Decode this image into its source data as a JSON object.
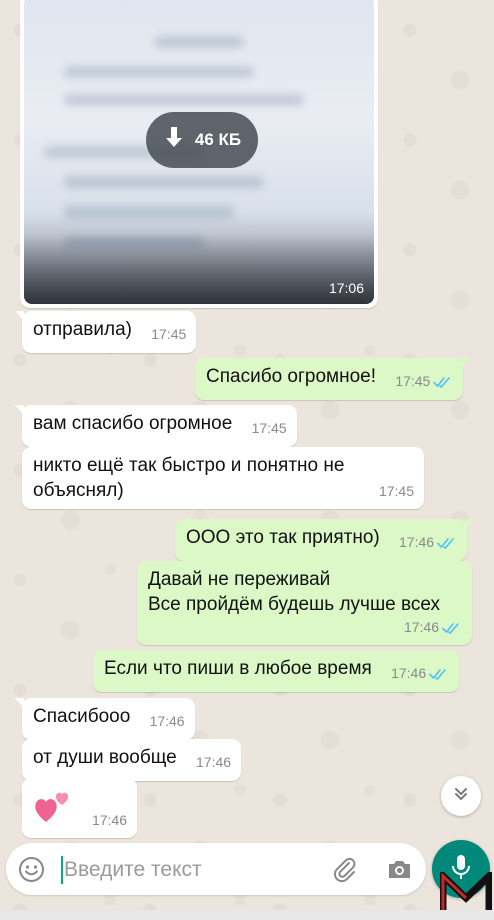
{
  "image_message": {
    "download_size": "46 КБ",
    "time": "17:06"
  },
  "messages": [
    {
      "dir": "in",
      "text": "отправила)",
      "time": "17:45"
    },
    {
      "dir": "out",
      "text": "Спасибо огромное!",
      "time": "17:45",
      "status": "read"
    },
    {
      "dir": "in",
      "text": "вам спасибо огромное",
      "time": "17:45"
    },
    {
      "dir": "in",
      "lines": [
        "никто ещё так быстро и понятно не",
        "объяснял)"
      ],
      "time": "17:45"
    },
    {
      "dir": "out",
      "text": "ООО это так приятно)",
      "time": "17:46",
      "status": "read"
    },
    {
      "dir": "out",
      "lines": [
        "Давай не переживай",
        "Все пройдём будешь лучше всех"
      ],
      "time": "17:46",
      "status": "read"
    },
    {
      "dir": "out",
      "text": "Если что пиши в любое время",
      "time": "17:46",
      "status": "read"
    },
    {
      "dir": "in",
      "text": "Спасибооо",
      "time": "17:46"
    },
    {
      "dir": "in",
      "text": "от души вообще",
      "time": "17:46"
    },
    {
      "dir": "in",
      "emoji": "two-hearts",
      "time": "17:46"
    }
  ],
  "composer": {
    "placeholder": "Введите текст"
  },
  "colors": {
    "outgoing_bubble": "#dcf8c6",
    "incoming_bubble": "#ffffff",
    "read_check": "#4fc3f7",
    "mic_button": "#00897b",
    "wallpaper": "#ece5dd"
  },
  "icons": [
    "download-icon",
    "read-check-icon",
    "chevron-double-down-icon",
    "emoji-icon",
    "paperclip-icon",
    "camera-icon",
    "microphone-icon",
    "watermark-logo"
  ]
}
